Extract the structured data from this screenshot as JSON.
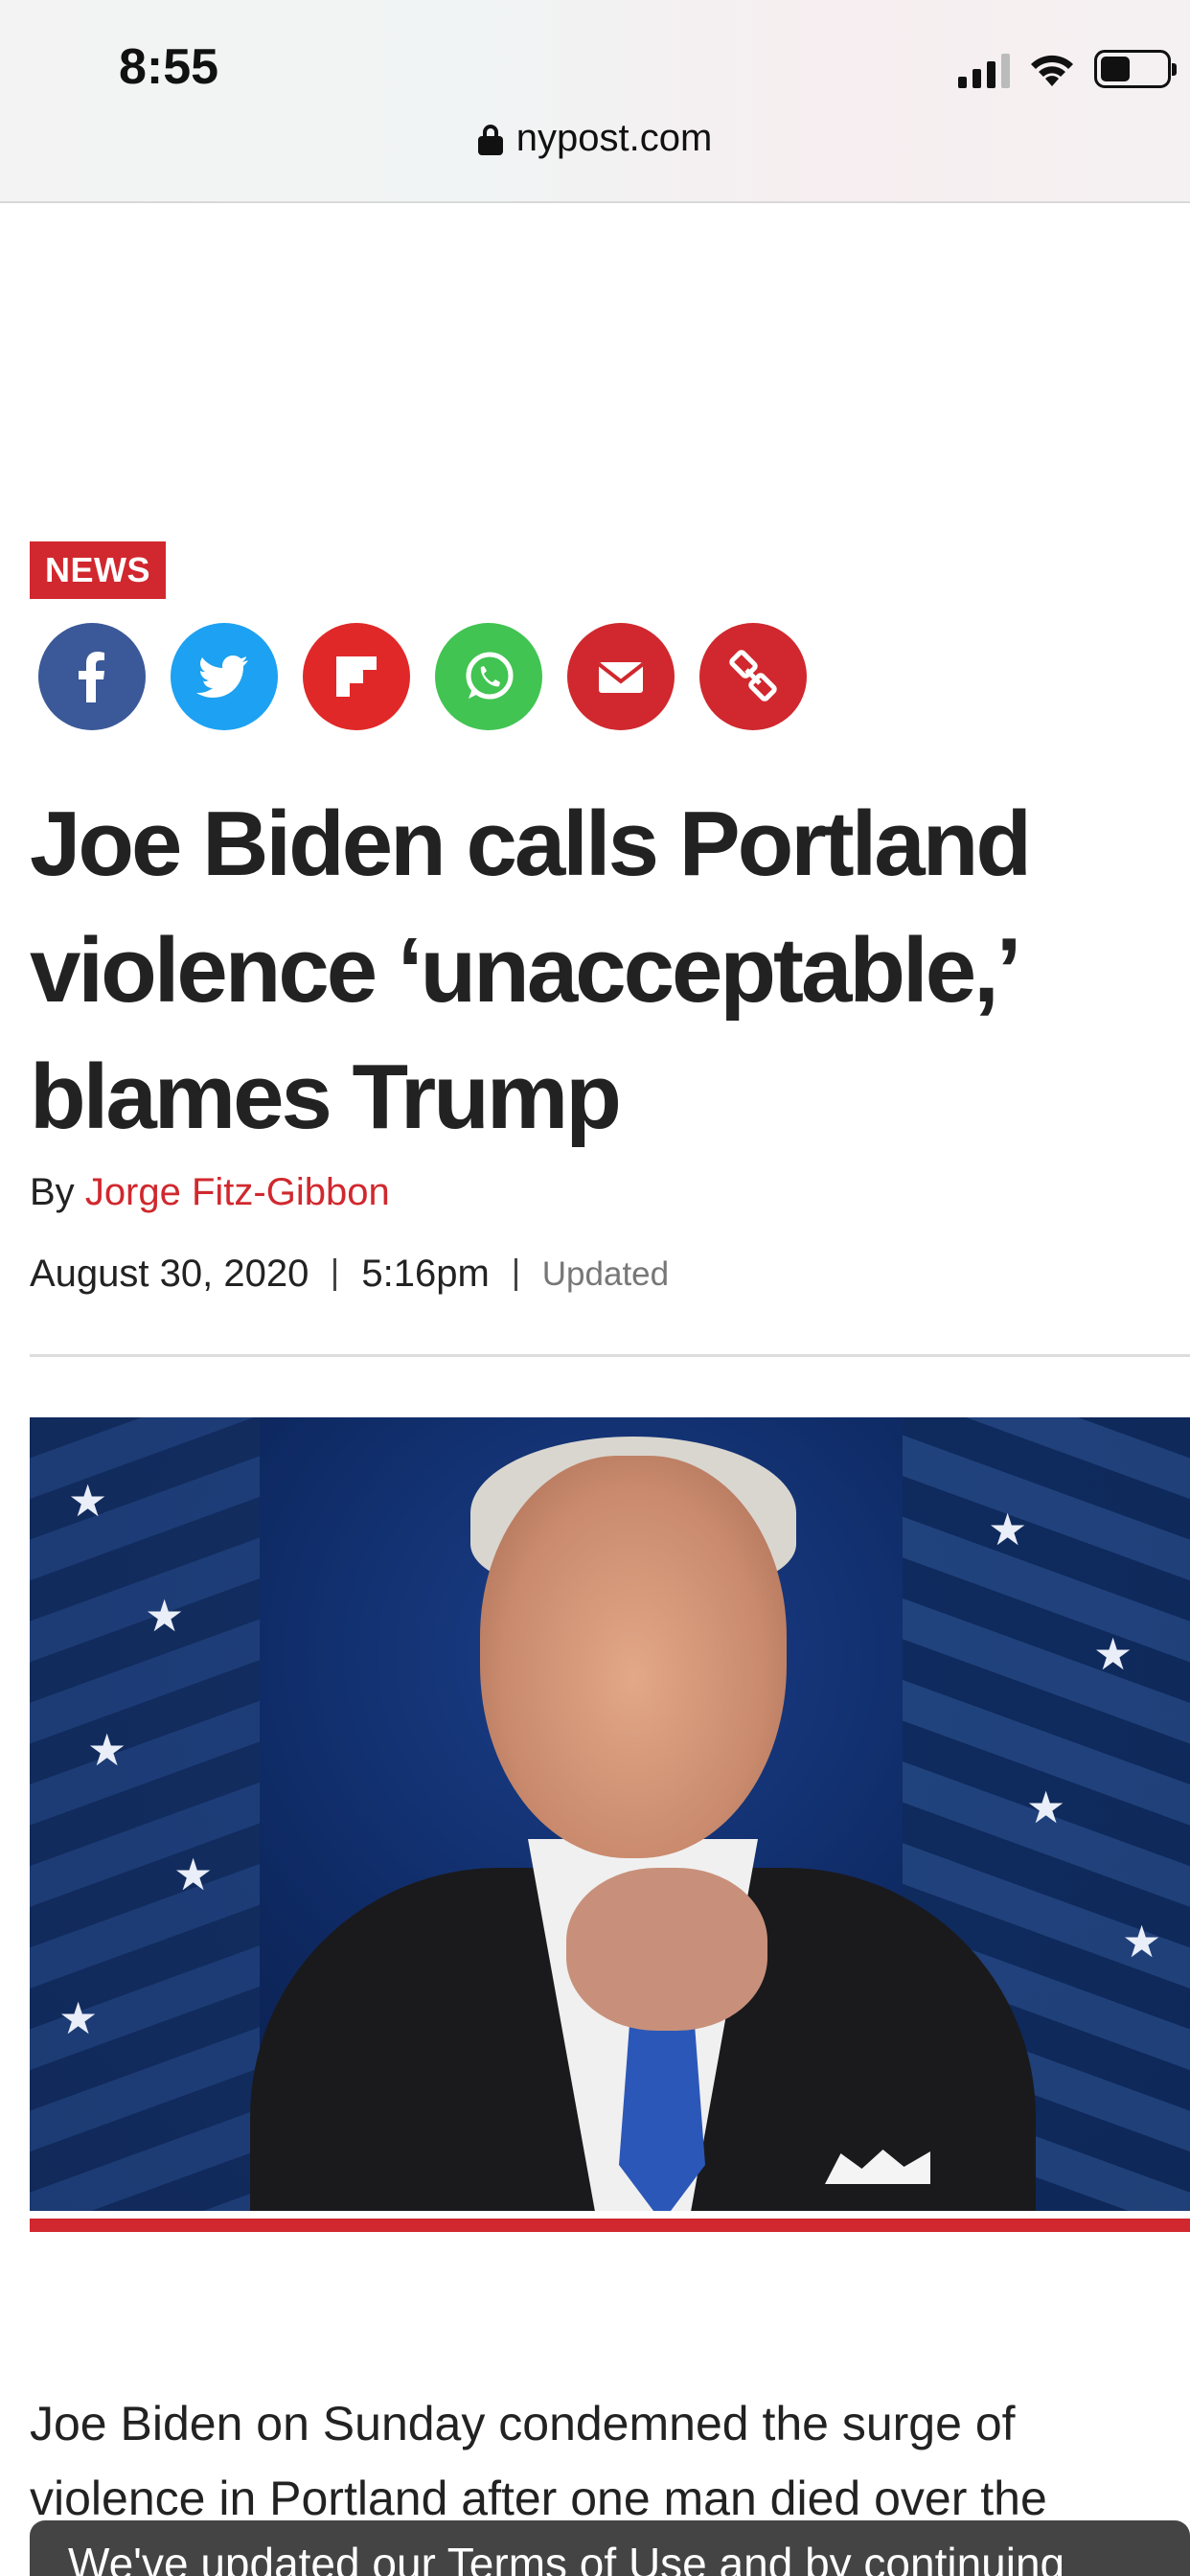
{
  "status_bar": {
    "time": "8:55"
  },
  "browser": {
    "url": "nypost.com"
  },
  "article": {
    "section": "NEWS",
    "share_buttons": [
      "facebook",
      "twitter",
      "flipboard",
      "whatsapp",
      "email",
      "copy-link"
    ],
    "headline": "Joe Biden calls Portland violence ‘unacceptable,’ blames Trump",
    "byline_prefix": "By",
    "author": "Jorge Fitz-Gibbon",
    "date": "August 30, 2020",
    "time": "5:16pm",
    "updated_label": "Updated",
    "body_text": "Joe Biden on Sunday condemned the surge of violence in Portland after one man died over the",
    "cookie_banner_text": "We've updated our Terms of Use and by continuing"
  },
  "colors": {
    "brand_red": "#d0282e",
    "facebook": "#3b5998",
    "twitter": "#1da1f2",
    "whatsapp": "#41c452"
  }
}
